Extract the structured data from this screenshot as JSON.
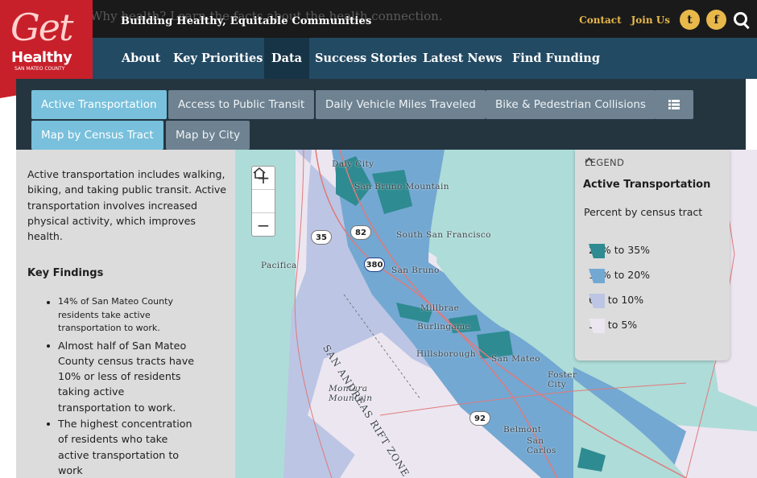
{
  "header": {
    "ghost_text": "Why health? Learn the facts about the health connection.",
    "tagline": "Building Healthy, Equitable Communities",
    "contact": "Contact",
    "join": "Join Us",
    "twitter_glyph": "t",
    "facebook_glyph": "f",
    "icons": [
      "twitter-icon",
      "facebook-icon",
      "search-icon"
    ],
    "accent_color": "#e8b84a"
  },
  "logo": {
    "get": "Get",
    "healthy": "Healthy",
    "county": "SAN MATEO COUNTY",
    "color": "#c8202b"
  },
  "nav": [
    {
      "label": "About"
    },
    {
      "label": "Key Priorities"
    },
    {
      "label": "Data"
    },
    {
      "label": "Success Stories"
    },
    {
      "label": "Latest News"
    },
    {
      "label": "Find Funding"
    }
  ],
  "tabs": [
    {
      "label": "Active Transportation",
      "active": true
    },
    {
      "label": "Access to Public Transit"
    },
    {
      "label": "Daily Vehicle Miles Traveled"
    },
    {
      "label": "Bike & Pedestrian Collisions"
    },
    {
      "label": "",
      "icon": "list-icon"
    },
    {
      "label": "Map by Census Tract",
      "active": true
    },
    {
      "label": "Map by City"
    }
  ],
  "sidebar": {
    "intro": "Active transportation includes walking, biking, and taking public transit. Active transportation involves increased physical activity, which improves health.",
    "findings_title": "Key Findings",
    "findings": [
      "14% of San Mateo County residents take active transportation to work.",
      "Almost half of San Mateo County census tracts have 10% or less of residents taking active transportation to work.",
      "The highest concentration of residents who take active transportation to work"
    ]
  },
  "map": {
    "zoom_in": "+",
    "zoom_out": "−",
    "labels": [
      "Daly City",
      "San Bruno Mountain",
      "South San Francisco",
      "Pacifica",
      "San Bruno",
      "Millbrae",
      "Burlingame",
      "Hillsborough",
      "San Mateo",
      "Foster City",
      "Montara Mountain",
      "Belmont",
      "San Carlos",
      "SAN ANDREAS RIFT ZONE"
    ],
    "highways": [
      "35",
      "82",
      "380",
      "92"
    ]
  },
  "legend": {
    "toggle": "LEGEND",
    "title": "Active Transportation",
    "subtitle": "Percent by census tract",
    "items": [
      {
        "label": "21% to 35%",
        "color": "#2e8b91"
      },
      {
        "label": "11% to 20%",
        "color": "#73a8d2"
      },
      {
        "label": "6% to 10%",
        "color": "#bcc5e4"
      },
      {
        "label": "3% to 5%",
        "color": "#ece6f0"
      }
    ]
  }
}
